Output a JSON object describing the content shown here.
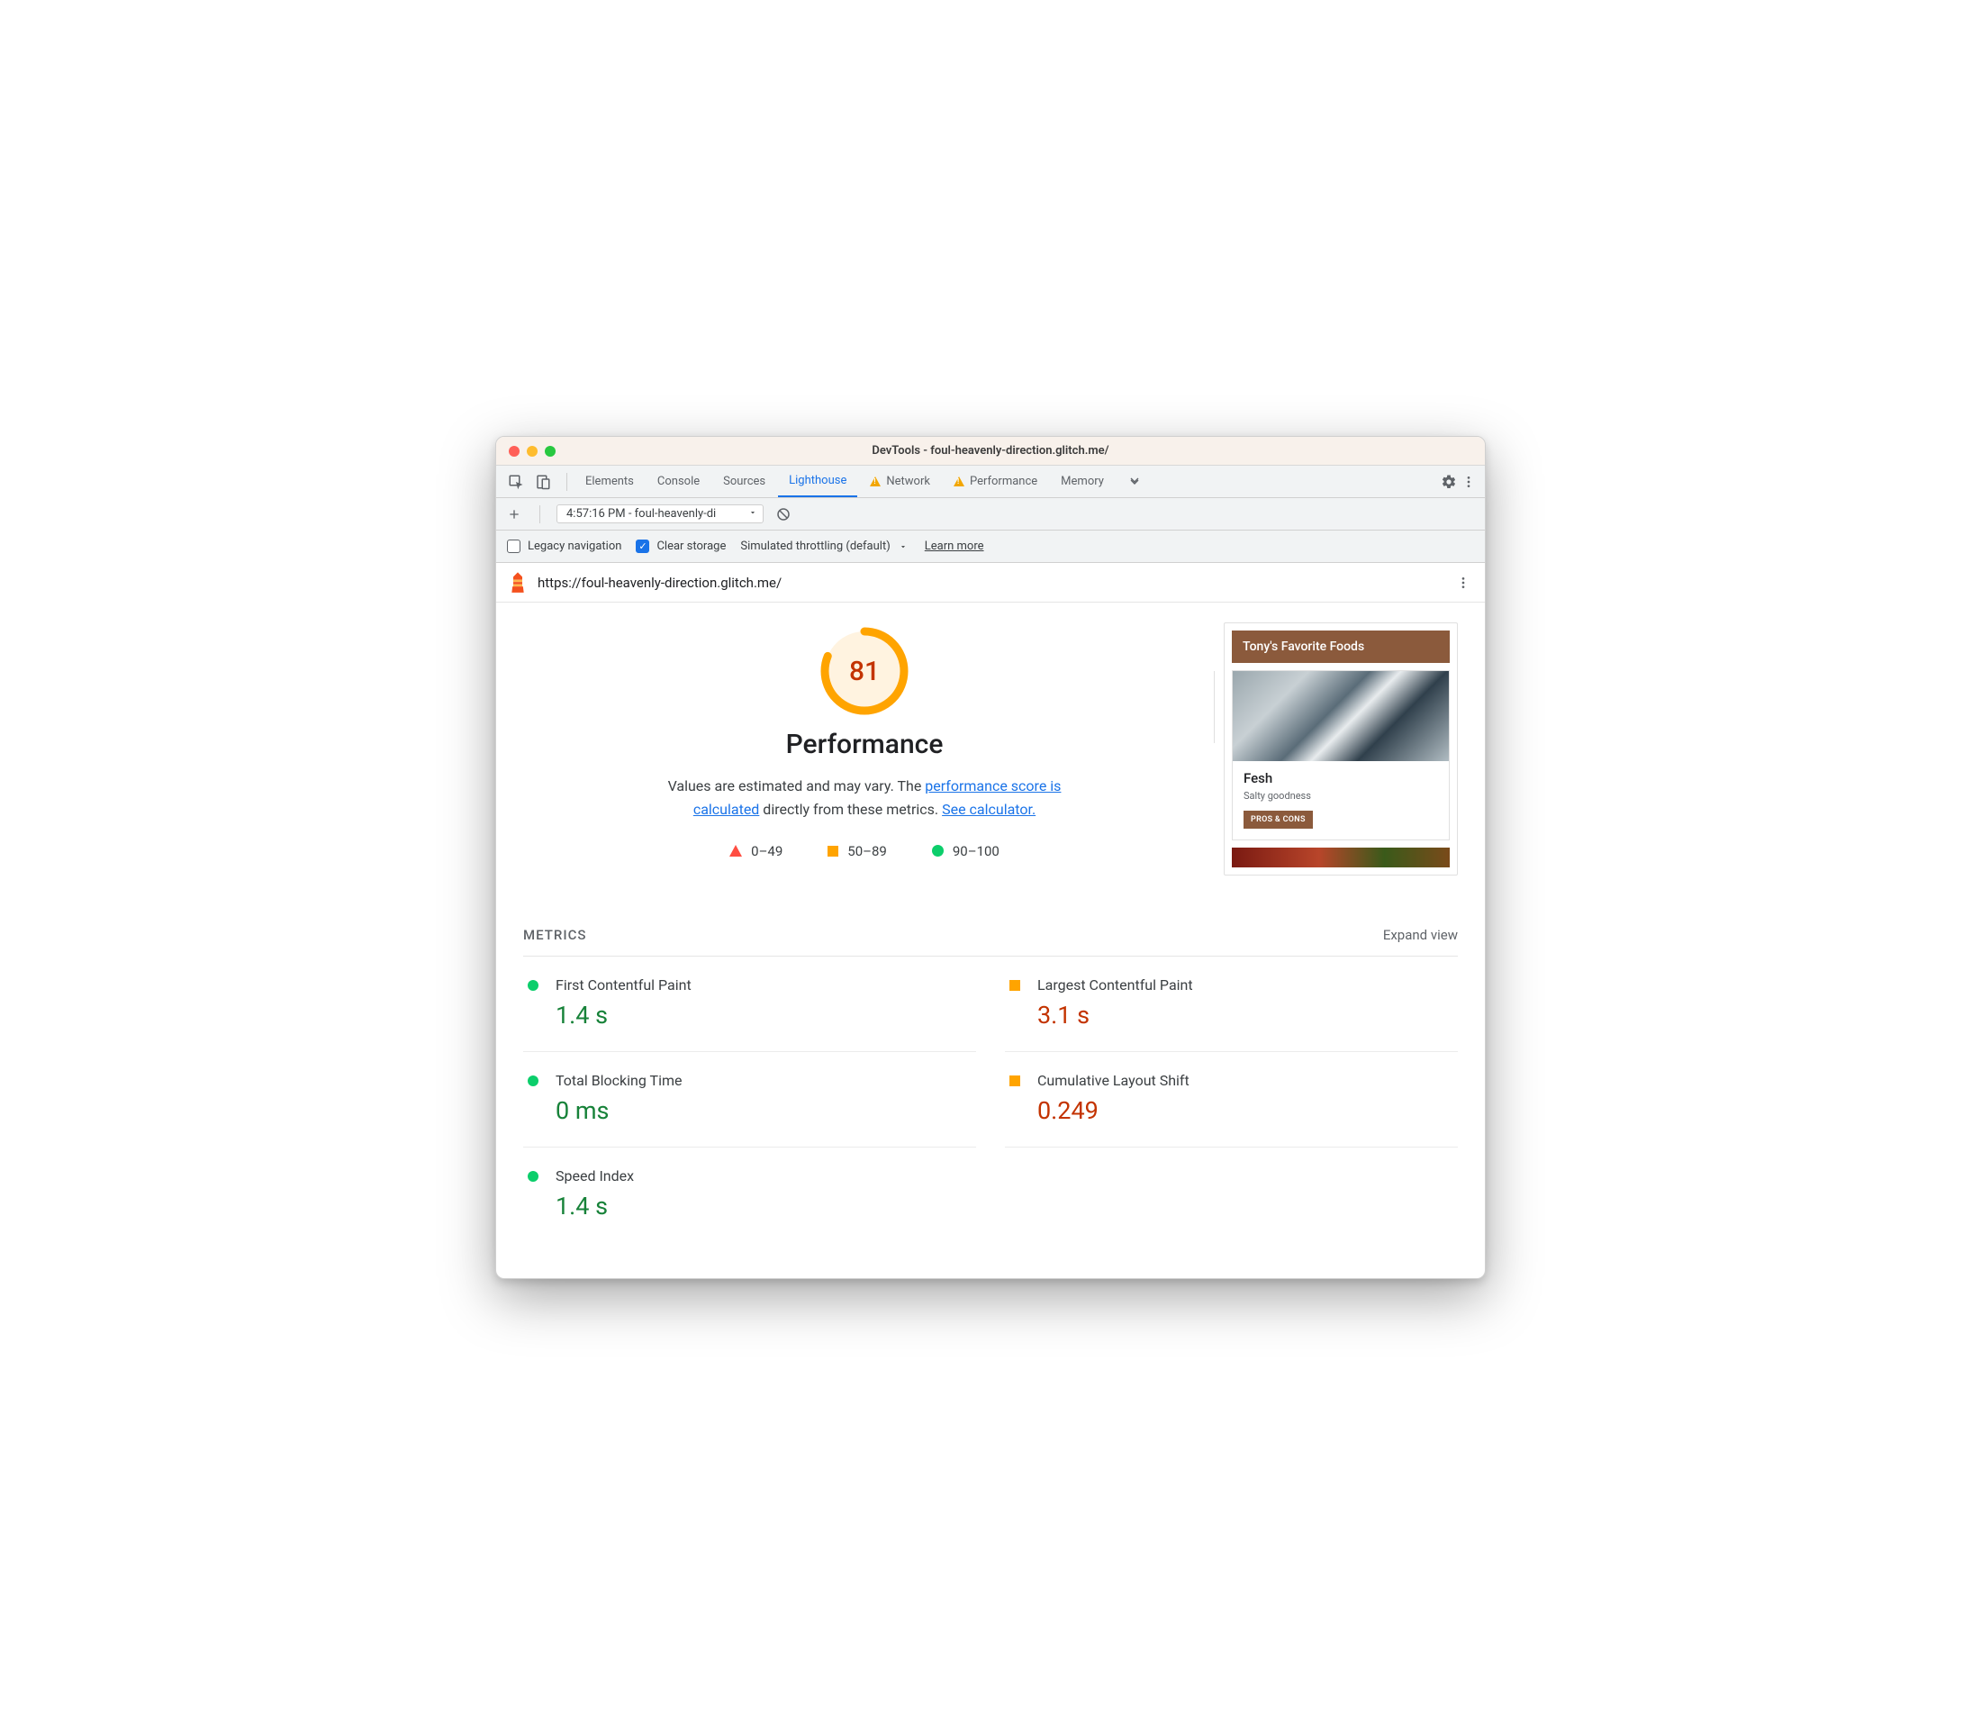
{
  "window": {
    "title": "DevTools - foul-heavenly-direction.glitch.me/"
  },
  "tabs": {
    "elements": "Elements",
    "console": "Console",
    "sources": "Sources",
    "lighthouse": "Lighthouse",
    "network": "Network",
    "performance": "Performance",
    "memory": "Memory"
  },
  "subbar": {
    "report_label": "4:57:16 PM - foul-heavenly-di"
  },
  "options": {
    "legacy": "Legacy navigation",
    "clear": "Clear storage",
    "throttling": "Simulated throttling (default)",
    "learn": "Learn more"
  },
  "urlbar": {
    "url": "https://foul-heavenly-direction.glitch.me/"
  },
  "summary": {
    "score": "81",
    "title": "Performance",
    "desc_pre": "Values are estimated and may vary. The ",
    "link1": "performance score is calculated",
    "desc_mid": " directly from these metrics. ",
    "link2": "See calculator.",
    "legend": {
      "r": "0–49",
      "o": "50–89",
      "g": "90–100"
    }
  },
  "preview": {
    "header": "Tony's Favorite Foods",
    "item_title": "Fesh",
    "item_sub": "Salty goodness",
    "btn": "PROS & CONS"
  },
  "metrics": {
    "title": "METRICS",
    "expand": "Expand view",
    "items": [
      {
        "name": "First Contentful Paint",
        "value": "1.4 s",
        "status": "good"
      },
      {
        "name": "Largest Contentful Paint",
        "value": "3.1 s",
        "status": "avg"
      },
      {
        "name": "Total Blocking Time",
        "value": "0 ms",
        "status": "good"
      },
      {
        "name": "Cumulative Layout Shift",
        "value": "0.249",
        "status": "avg"
      },
      {
        "name": "Speed Index",
        "value": "1.4 s",
        "status": "good"
      }
    ]
  }
}
